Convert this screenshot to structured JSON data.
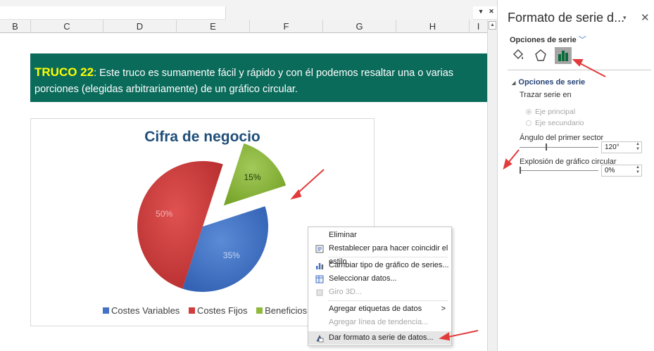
{
  "sheet": {
    "columns": [
      "B",
      "C",
      "D",
      "E",
      "F",
      "G",
      "H",
      "I"
    ],
    "scroll_dropdown": "▾",
    "scroll_close": "✕"
  },
  "banner": {
    "label": "TRUCO 22",
    "text": ": Este truco es sumamente fácil y rápido y con él podemos resaltar una o varias porciones (elegidas arbitrariamente) de un gráfico circular.",
    "bg_color": "#0b6b5b"
  },
  "chart_data": {
    "type": "pie",
    "title": "Cifra de negocio",
    "categories": [
      "Costes Variables",
      "Costes Fijos",
      "Beneficios"
    ],
    "values": [
      35,
      50,
      15
    ],
    "labels": [
      "35%",
      "50%",
      "15%"
    ],
    "colors": [
      "#4472c4",
      "#d13c3c",
      "#8fba3c"
    ],
    "first_slice_angle_deg": 120,
    "exploded_slice": "Beneficios",
    "legend_position": "bottom"
  },
  "context_menu": {
    "items": [
      {
        "label": "Eliminar",
        "icon": "",
        "disabled": false,
        "highlighted": false
      },
      {
        "label": "Restablecer para hacer coincidir el estilo",
        "icon": "reset-style-icon",
        "disabled": false,
        "highlighted": false
      },
      {
        "label": "Cambiar tipo de gráfico de series...",
        "icon": "chart-type-icon",
        "disabled": false,
        "highlighted": false
      },
      {
        "label": "Seleccionar datos...",
        "icon": "select-data-icon",
        "disabled": false,
        "highlighted": false
      },
      {
        "label": "Giro 3D...",
        "icon": "rotation-3d-icon",
        "disabled": true,
        "highlighted": false
      },
      {
        "label": "Agregar etiquetas de datos",
        "icon": "",
        "disabled": false,
        "highlighted": false,
        "submenu": ">"
      },
      {
        "label": "Agregar línea de tendencia...",
        "icon": "",
        "disabled": true,
        "highlighted": false
      },
      {
        "label": "Dar formato a serie de datos...",
        "icon": "format-series-icon",
        "disabled": false,
        "highlighted": true
      }
    ]
  },
  "pane": {
    "title": "Formato de serie d...",
    "dropdown": "▾",
    "close": "✕",
    "subtitle": "Opciones de serie",
    "subtitle_chevron": "﹀",
    "section_title": "Opciones de serie",
    "section_toggle": "◢",
    "plot_series_on": "Trazar serie en",
    "axis_primary": "Eje principal",
    "axis_secondary": "Eje secundario",
    "angle_label": "Ángulo del primer sector",
    "angle_value": "120°",
    "explosion_label": "Explosión de gráfico circular",
    "explosion_value": "0%",
    "angle_fraction": 0.333,
    "explosion_fraction": 0.0,
    "spin_arrows": "▲▼"
  }
}
